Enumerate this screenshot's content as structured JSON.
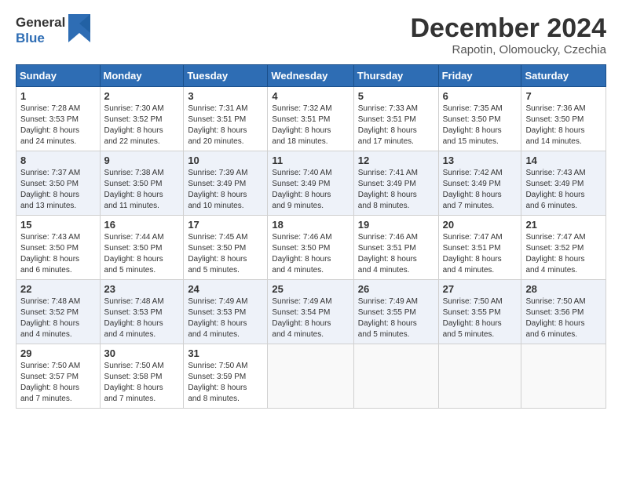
{
  "logo": {
    "line1": "General",
    "line2": "Blue"
  },
  "header": {
    "month": "December 2024",
    "location": "Rapotin, Olomoucky, Czechia"
  },
  "weekdays": [
    "Sunday",
    "Monday",
    "Tuesday",
    "Wednesday",
    "Thursday",
    "Friday",
    "Saturday"
  ],
  "weeks": [
    [
      {
        "day": "1",
        "info": "Sunrise: 7:28 AM\nSunset: 3:53 PM\nDaylight: 8 hours\nand 24 minutes."
      },
      {
        "day": "2",
        "info": "Sunrise: 7:30 AM\nSunset: 3:52 PM\nDaylight: 8 hours\nand 22 minutes."
      },
      {
        "day": "3",
        "info": "Sunrise: 7:31 AM\nSunset: 3:51 PM\nDaylight: 8 hours\nand 20 minutes."
      },
      {
        "day": "4",
        "info": "Sunrise: 7:32 AM\nSunset: 3:51 PM\nDaylight: 8 hours\nand 18 minutes."
      },
      {
        "day": "5",
        "info": "Sunrise: 7:33 AM\nSunset: 3:51 PM\nDaylight: 8 hours\nand 17 minutes."
      },
      {
        "day": "6",
        "info": "Sunrise: 7:35 AM\nSunset: 3:50 PM\nDaylight: 8 hours\nand 15 minutes."
      },
      {
        "day": "7",
        "info": "Sunrise: 7:36 AM\nSunset: 3:50 PM\nDaylight: 8 hours\nand 14 minutes."
      }
    ],
    [
      {
        "day": "8",
        "info": "Sunrise: 7:37 AM\nSunset: 3:50 PM\nDaylight: 8 hours\nand 13 minutes."
      },
      {
        "day": "9",
        "info": "Sunrise: 7:38 AM\nSunset: 3:50 PM\nDaylight: 8 hours\nand 11 minutes."
      },
      {
        "day": "10",
        "info": "Sunrise: 7:39 AM\nSunset: 3:49 PM\nDaylight: 8 hours\nand 10 minutes."
      },
      {
        "day": "11",
        "info": "Sunrise: 7:40 AM\nSunset: 3:49 PM\nDaylight: 8 hours\nand 9 minutes."
      },
      {
        "day": "12",
        "info": "Sunrise: 7:41 AM\nSunset: 3:49 PM\nDaylight: 8 hours\nand 8 minutes."
      },
      {
        "day": "13",
        "info": "Sunrise: 7:42 AM\nSunset: 3:49 PM\nDaylight: 8 hours\nand 7 minutes."
      },
      {
        "day": "14",
        "info": "Sunrise: 7:43 AM\nSunset: 3:49 PM\nDaylight: 8 hours\nand 6 minutes."
      }
    ],
    [
      {
        "day": "15",
        "info": "Sunrise: 7:43 AM\nSunset: 3:50 PM\nDaylight: 8 hours\nand 6 minutes."
      },
      {
        "day": "16",
        "info": "Sunrise: 7:44 AM\nSunset: 3:50 PM\nDaylight: 8 hours\nand 5 minutes."
      },
      {
        "day": "17",
        "info": "Sunrise: 7:45 AM\nSunset: 3:50 PM\nDaylight: 8 hours\nand 5 minutes."
      },
      {
        "day": "18",
        "info": "Sunrise: 7:46 AM\nSunset: 3:50 PM\nDaylight: 8 hours\nand 4 minutes."
      },
      {
        "day": "19",
        "info": "Sunrise: 7:46 AM\nSunset: 3:51 PM\nDaylight: 8 hours\nand 4 minutes."
      },
      {
        "day": "20",
        "info": "Sunrise: 7:47 AM\nSunset: 3:51 PM\nDaylight: 8 hours\nand 4 minutes."
      },
      {
        "day": "21",
        "info": "Sunrise: 7:47 AM\nSunset: 3:52 PM\nDaylight: 8 hours\nand 4 minutes."
      }
    ],
    [
      {
        "day": "22",
        "info": "Sunrise: 7:48 AM\nSunset: 3:52 PM\nDaylight: 8 hours\nand 4 minutes."
      },
      {
        "day": "23",
        "info": "Sunrise: 7:48 AM\nSunset: 3:53 PM\nDaylight: 8 hours\nand 4 minutes."
      },
      {
        "day": "24",
        "info": "Sunrise: 7:49 AM\nSunset: 3:53 PM\nDaylight: 8 hours\nand 4 minutes."
      },
      {
        "day": "25",
        "info": "Sunrise: 7:49 AM\nSunset: 3:54 PM\nDaylight: 8 hours\nand 4 minutes."
      },
      {
        "day": "26",
        "info": "Sunrise: 7:49 AM\nSunset: 3:55 PM\nDaylight: 8 hours\nand 5 minutes."
      },
      {
        "day": "27",
        "info": "Sunrise: 7:50 AM\nSunset: 3:55 PM\nDaylight: 8 hours\nand 5 minutes."
      },
      {
        "day": "28",
        "info": "Sunrise: 7:50 AM\nSunset: 3:56 PM\nDaylight: 8 hours\nand 6 minutes."
      }
    ],
    [
      {
        "day": "29",
        "info": "Sunrise: 7:50 AM\nSunset: 3:57 PM\nDaylight: 8 hours\nand 7 minutes."
      },
      {
        "day": "30",
        "info": "Sunrise: 7:50 AM\nSunset: 3:58 PM\nDaylight: 8 hours\nand 7 minutes."
      },
      {
        "day": "31",
        "info": "Sunrise: 7:50 AM\nSunset: 3:59 PM\nDaylight: 8 hours\nand 8 minutes."
      },
      {
        "day": "",
        "info": ""
      },
      {
        "day": "",
        "info": ""
      },
      {
        "day": "",
        "info": ""
      },
      {
        "day": "",
        "info": ""
      }
    ]
  ]
}
